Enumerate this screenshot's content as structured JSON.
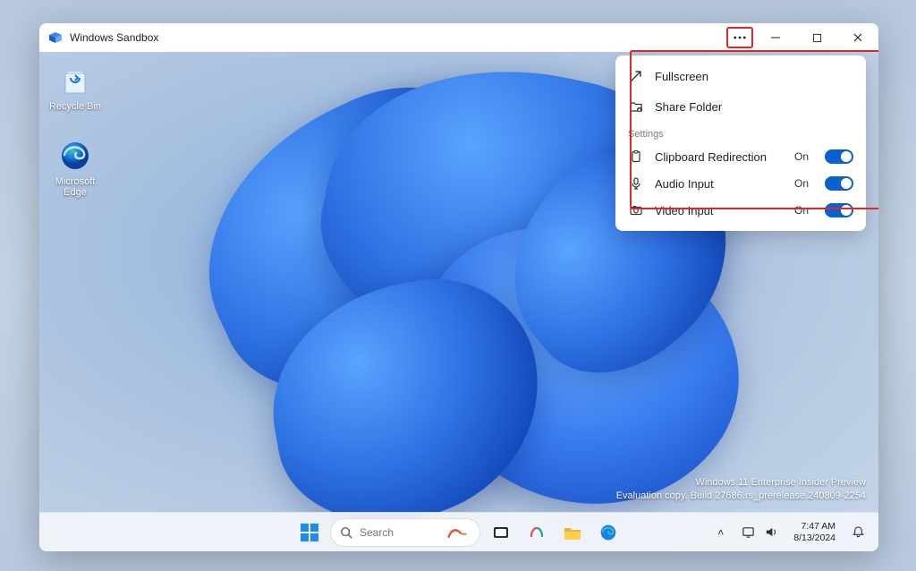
{
  "window": {
    "title": "Windows Sandbox"
  },
  "desktop_icons": [
    {
      "name": "recycle-bin",
      "label": "Recycle Bin"
    },
    {
      "name": "microsoft-edge",
      "label": "Microsoft Edge"
    }
  ],
  "menu": {
    "items": [
      {
        "icon": "expand-icon",
        "label": "Fullscreen"
      },
      {
        "icon": "folder-share-icon",
        "label": "Share Folder"
      }
    ],
    "section_label": "Settings",
    "settings": [
      {
        "icon": "clipboard-icon",
        "label": "Clipboard Redirection",
        "state": "On"
      },
      {
        "icon": "microphone-icon",
        "label": "Audio Input",
        "state": "On"
      },
      {
        "icon": "camera-icon",
        "label": "Video Input",
        "state": "On"
      }
    ]
  },
  "watermark": {
    "line1": "Windows 11 Enterprise Insider Preview",
    "line2": "Evaluation copy. Build 27686.rs_prerelease.240809-2254"
  },
  "taskbar": {
    "search_placeholder": "Search",
    "tray_chevron": "˄",
    "clock": {
      "time": "7:47 AM",
      "date": "8/13/2024"
    }
  },
  "colors": {
    "accent": "#0a5fd1",
    "highlight": "#d92a2a"
  }
}
